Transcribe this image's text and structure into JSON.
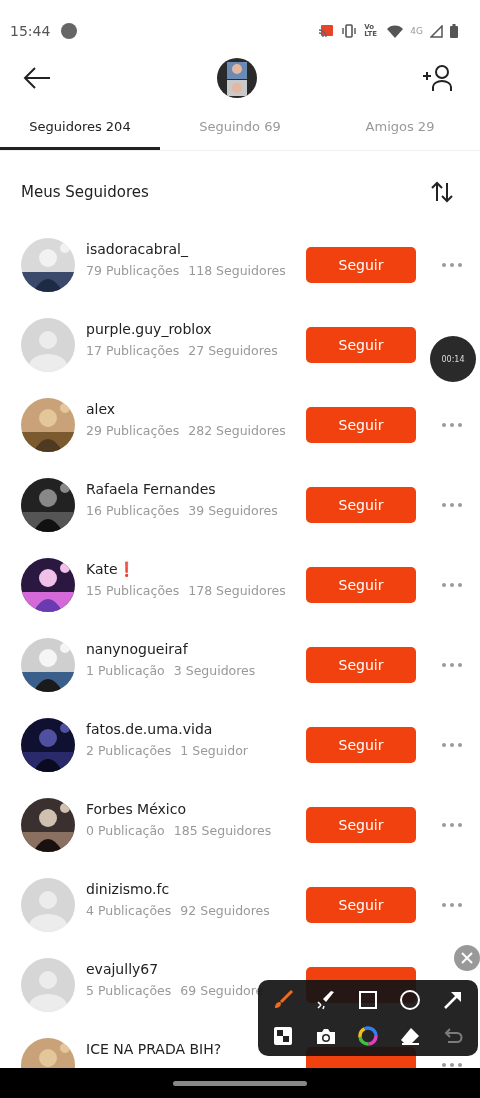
{
  "status_bar": {
    "time": "15:44",
    "network_labels": [
      "Vo LTE",
      "4G"
    ]
  },
  "header": {
    "avatar": {
      "kind": "picture"
    }
  },
  "tabs": [
    {
      "label": "Seguidores 204",
      "selected": true
    },
    {
      "label": "Seguindo 69",
      "selected": false
    },
    {
      "label": "Amigos 29",
      "selected": false
    }
  ],
  "section": {
    "title": "Meus Seguidores"
  },
  "followers": [
    {
      "name": "isadoracabral_",
      "stats": [
        "79 Publicações",
        "118 Seguidores"
      ],
      "avatar": {
        "kind": "picture"
      },
      "button": "Seguir",
      "more": true
    },
    {
      "name": "purple.guy_roblox",
      "stats": [
        "17 Publicações",
        "27 Seguidores"
      ],
      "avatar": {
        "kind": "placeholder"
      },
      "button": "Seguir",
      "more": false
    },
    {
      "name": "alex",
      "stats": [
        "29 Publicações",
        "282 Seguidores"
      ],
      "avatar": {
        "kind": "picture"
      },
      "button": "Seguir",
      "more": true
    },
    {
      "name": "Rafaela Fernandes",
      "stats": [
        "16 Publicações",
        "39 Seguidores"
      ],
      "avatar": {
        "kind": "picture"
      },
      "button": "Seguir",
      "more": true
    },
    {
      "name": "Kate❗",
      "stats": [
        "15 Publicações",
        "178 Seguidores"
      ],
      "avatar": {
        "kind": "picture"
      },
      "button": "Seguir",
      "more": true
    },
    {
      "name": "nanynogueiraf",
      "stats": [
        "1 Publicação",
        "3 Seguidores"
      ],
      "avatar": {
        "kind": "picture"
      },
      "button": "Seguir",
      "more": true
    },
    {
      "name": "fatos.de.uma.vida",
      "stats": [
        "2 Publicações",
        "1 Seguidor"
      ],
      "avatar": {
        "kind": "picture"
      },
      "button": "Seguir",
      "more": true
    },
    {
      "name": "Forbes México",
      "stats": [
        "0 Publicação",
        "185 Seguidores"
      ],
      "avatar": {
        "kind": "picture"
      },
      "button": "Seguir",
      "more": true
    },
    {
      "name": "dinizismo.fc",
      "stats": [
        "4 Publicações",
        "92 Seguidores"
      ],
      "avatar": {
        "kind": "placeholder"
      },
      "button": "Seguir",
      "more": true
    },
    {
      "name": "evajully67",
      "stats": [
        "5 Publicações",
        "69 Seguidore"
      ],
      "avatar": {
        "kind": "placeholder"
      },
      "more": false
    },
    {
      "name": "ICE NA PRADA BIH?",
      "avatar": {
        "kind": "picture"
      },
      "more": true
    }
  ],
  "recording_timer": {
    "time": "00:14"
  },
  "drawing_toolbar": {
    "tools": [
      {
        "kind": "brush",
        "selected": true,
        "disabled": false
      },
      {
        "kind": "highlighter",
        "selected": false,
        "disabled": false
      },
      {
        "kind": "square",
        "selected": false,
        "disabled": false
      },
      {
        "kind": "circle",
        "selected": false,
        "disabled": false
      },
      {
        "kind": "arrow",
        "selected": false,
        "disabled": false
      },
      {
        "kind": "mosaic",
        "selected": false,
        "disabled": false
      },
      {
        "kind": "camera",
        "selected": false,
        "disabled": false
      },
      {
        "kind": "color",
        "selected": false,
        "disabled": false
      },
      {
        "kind": "eraser",
        "selected": false,
        "disabled": false
      },
      {
        "kind": "undo",
        "selected": false,
        "disabled": true
      }
    ]
  }
}
